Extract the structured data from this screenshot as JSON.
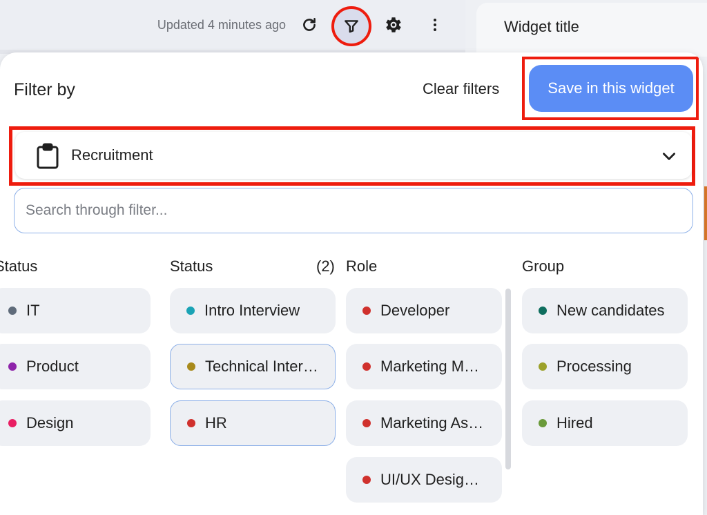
{
  "topbar": {
    "updated_text": "Updated 4 minutes ago",
    "icons": [
      "refresh-icon",
      "filter-icon",
      "settings-icon",
      "more-vert-icon"
    ]
  },
  "widget": {
    "title": "Widget title"
  },
  "filter_panel": {
    "title": "Filter by",
    "clear_label": "Clear filters",
    "save_label": "Save in this widget",
    "dropdown": {
      "icon": "clipboard-icon",
      "value": "Recruitment"
    },
    "search": {
      "value": "",
      "placeholder": "Search through filter..."
    },
    "columns": [
      {
        "header": "Status",
        "count": "",
        "items": [
          {
            "label": "IT",
            "color": "#5f6b7a",
            "selected": false
          },
          {
            "label": "Product",
            "color": "#8e24aa",
            "selected": false
          },
          {
            "label": "Design",
            "color": "#e91e63",
            "selected": false
          }
        ]
      },
      {
        "header": "Status",
        "count": "(2)",
        "items": [
          {
            "label": "Intro Interview",
            "color": "#1aa3b5",
            "selected": false
          },
          {
            "label": "Technical Interview",
            "color": "#a88a1c",
            "selected": true
          },
          {
            "label": "HR",
            "color": "#d0312d",
            "selected": true
          }
        ]
      },
      {
        "header": "Role",
        "count": "",
        "items": [
          {
            "label": "Developer",
            "color": "#d0312d",
            "selected": false
          },
          {
            "label": "Marketing Manager",
            "color": "#d0312d",
            "selected": false
          },
          {
            "label": "Marketing Assistant",
            "color": "#d0312d",
            "selected": false
          },
          {
            "label": "UI/UX Designer",
            "color": "#d0312d",
            "selected": false
          }
        ]
      },
      {
        "header": "Group",
        "count": "",
        "items": [
          {
            "label": "New candidates",
            "color": "#0f6e5e",
            "selected": false
          },
          {
            "label": "Processing",
            "color": "#9ca12a",
            "selected": false
          },
          {
            "label": "Hired",
            "color": "#6a9a3a",
            "selected": false
          }
        ]
      }
    ]
  },
  "colors": {
    "accent": "#5b8df5",
    "highlight": "#ee1c0e"
  }
}
